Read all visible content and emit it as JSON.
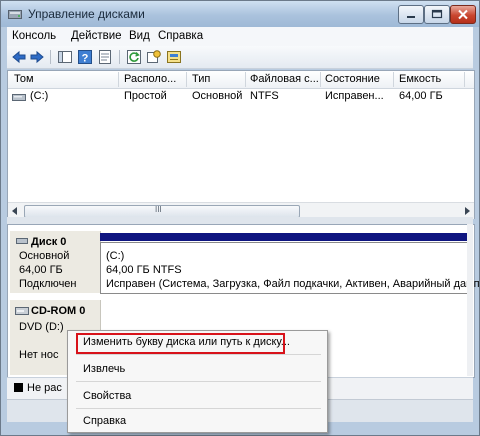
{
  "window": {
    "title": "Управление дисками"
  },
  "menu": [
    "Консоль",
    "Действие",
    "Вид",
    "Справка"
  ],
  "toolbar": {
    "icons": [
      "back-icon",
      "forward-icon",
      "console-tree-icon",
      "help-icon",
      "properties-icon",
      "refresh-icon",
      "settings-icon",
      "disk-icon"
    ]
  },
  "volume_list": {
    "columns": [
      "Том",
      "Располо...",
      "Тип",
      "Файловая с...",
      "Состояние",
      "Емкость"
    ],
    "rows": [
      {
        "tom": "(C:)",
        "layout": "Простой",
        "type": "Основной",
        "fs": "NTFS",
        "status": "Исправен...",
        "capacity": "64,00 ГБ"
      }
    ],
    "scroll_mark": "III"
  },
  "disks": {
    "disk0": {
      "name": "Диск 0",
      "type": "Основной",
      "size": "64,00 ГБ",
      "state": "Подключен",
      "partition": {
        "label": "(C:)",
        "size_fs": "64,00 ГБ NTFS",
        "status": "Исправен (Система, Загрузка, Файл подкачки, Активен, Аварийный дамп п"
      }
    },
    "cdrom0": {
      "name": "CD-ROM 0",
      "drive": "DVD (D:)",
      "media": "Нет нос"
    }
  },
  "legend": {
    "label": "Не рас"
  },
  "context_menu": {
    "items": [
      "Изменить букву диска или путь к диску...",
      "Извлечь",
      "Свойства",
      "Справка"
    ]
  },
  "colors": {
    "partition_bar": "#0f1580",
    "highlight_border": "#d8121a"
  }
}
